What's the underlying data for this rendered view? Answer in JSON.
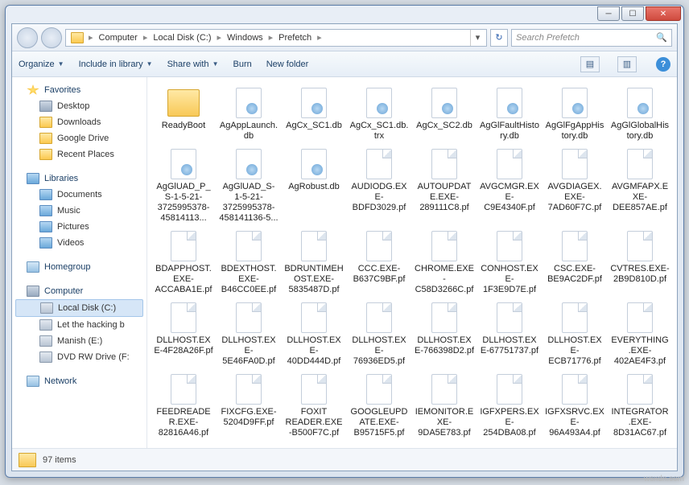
{
  "titlebar": {
    "min": "─",
    "max": "☐",
    "close": "✕"
  },
  "address": {
    "segs": [
      "Computer",
      "Local Disk (C:)",
      "Windows",
      "Prefetch"
    ],
    "search_placeholder": "Search Prefetch"
  },
  "toolbar": {
    "organize": "Organize",
    "include": "Include in library",
    "share": "Share with",
    "burn": "Burn",
    "newfolder": "New folder"
  },
  "nav": {
    "favorites": "Favorites",
    "fav_items": [
      "Desktop",
      "Downloads",
      "Google Drive",
      "Recent Places"
    ],
    "libraries": "Libraries",
    "lib_items": [
      "Documents",
      "Music",
      "Pictures",
      "Videos"
    ],
    "homegroup": "Homegroup",
    "computer": "Computer",
    "comp_items": [
      "Local Disk (C:)",
      "Let the hacking b",
      "Manish (E:)",
      "DVD RW Drive (F:"
    ],
    "network": "Network"
  },
  "files": [
    {
      "n": "ReadyBoot",
      "t": "fold"
    },
    {
      "n": "AgAppLaunch.db",
      "t": "db"
    },
    {
      "n": "AgCx_SC1.db",
      "t": "db"
    },
    {
      "n": "AgCx_SC1.db.trx",
      "t": "db"
    },
    {
      "n": "AgCx_SC2.db",
      "t": "db"
    },
    {
      "n": "AgGlFaultHistory.db",
      "t": "db"
    },
    {
      "n": "AgGlFgAppHistory.db",
      "t": "db"
    },
    {
      "n": "AgGlGlobalHistory.db",
      "t": "db"
    },
    {
      "n": "AgGlUAD_P_S-1-5-21-3725995378-45814113...",
      "t": "db"
    },
    {
      "n": "AgGlUAD_S-1-5-21-3725995378-458141136-5...",
      "t": "db"
    },
    {
      "n": "AgRobust.db",
      "t": "db"
    },
    {
      "n": "AUDIODG.EXE-BDFD3029.pf",
      "t": "pf"
    },
    {
      "n": "AUTOUPDATE.EXE-289111C8.pf",
      "t": "pf"
    },
    {
      "n": "AVGCMGR.EXE-C9E4340F.pf",
      "t": "pf"
    },
    {
      "n": "AVGDIAGEX.EXE-7AD60F7C.pf",
      "t": "pf"
    },
    {
      "n": "AVGMFAPX.EXE-DEE857AE.pf",
      "t": "pf"
    },
    {
      "n": "BDAPPHOST.EXE-ACCABA1E.pf",
      "t": "pf"
    },
    {
      "n": "BDEXTHOST.EXE-B46CC0EE.pf",
      "t": "pf"
    },
    {
      "n": "BDRUNTIMEHOST.EXE-5835487D.pf",
      "t": "pf"
    },
    {
      "n": "CCC.EXE-B637C9BF.pf",
      "t": "pf"
    },
    {
      "n": "CHROME.EXE-C58D3266C.pf",
      "t": "pf"
    },
    {
      "n": "CONHOST.EXE-1F3E9D7E.pf",
      "t": "pf"
    },
    {
      "n": "CSC.EXE-BE9AC2DF.pf",
      "t": "pf"
    },
    {
      "n": "CVTRES.EXE-2B9D810D.pf",
      "t": "pf"
    },
    {
      "n": "DLLHOST.EXE-4F28A26F.pf",
      "t": "pf"
    },
    {
      "n": "DLLHOST.EXE-5E46FA0D.pf",
      "t": "pf"
    },
    {
      "n": "DLLHOST.EXE-40DD444D.pf",
      "t": "pf"
    },
    {
      "n": "DLLHOST.EXE-76936ED5.pf",
      "t": "pf"
    },
    {
      "n": "DLLHOST.EXE-766398D2.pf",
      "t": "pf"
    },
    {
      "n": "DLLHOST.EXE-67751737.pf",
      "t": "pf"
    },
    {
      "n": "DLLHOST.EXE-ECB71776.pf",
      "t": "pf"
    },
    {
      "n": "EVERYTHING.EXE-402AE4F3.pf",
      "t": "pf"
    },
    {
      "n": "FEEDREADER.EXE-82816A46.pf",
      "t": "pf"
    },
    {
      "n": "FIXCFG.EXE-5204D9FF.pf",
      "t": "pf"
    },
    {
      "n": "FOXIT READER.EXE-B500F7C.pf",
      "t": "pf"
    },
    {
      "n": "GOOGLEUPDATE.EXE-B95715F5.pf",
      "t": "pf"
    },
    {
      "n": "IEMONITOR.EXE-9DA5E783.pf",
      "t": "pf"
    },
    {
      "n": "IGFXPERS.EXE-254DBA08.pf",
      "t": "pf"
    },
    {
      "n": "IGFXSRVC.EXE-96A493A4.pf",
      "t": "pf"
    },
    {
      "n": "INTEGRATOR.EXE-8D31AC67.pf",
      "t": "pf"
    }
  ],
  "status": {
    "count": "97 items"
  },
  "watermark": "wsxdn.com"
}
